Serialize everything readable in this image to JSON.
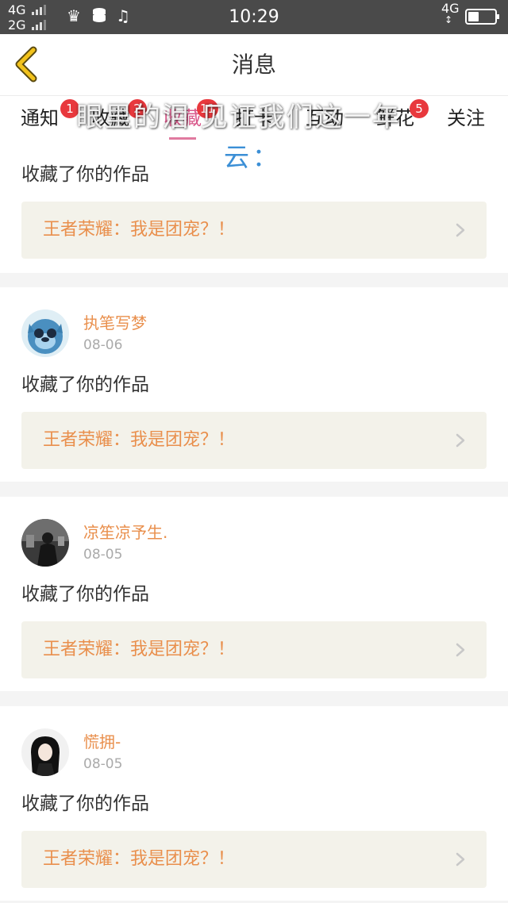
{
  "status_bar": {
    "network_1": "4G",
    "network_2": "2G",
    "time": "10:29",
    "network_right": "4G",
    "battery_level": 0.4
  },
  "header": {
    "title": "消息"
  },
  "tabs": [
    {
      "label": "通知",
      "badge": "1"
    },
    {
      "label": "收藏",
      "badge": "2"
    },
    {
      "label": "收藏",
      "badge": "11"
    },
    {
      "label": "打卡",
      "badge": ""
    },
    {
      "label": "互动",
      "badge": ""
    },
    {
      "label": "鲜花",
      "badge": "5"
    },
    {
      "label": "关注",
      "badge": ""
    }
  ],
  "overlay_caption": {
    "line1": "眼里的泪 见证我们这一年",
    "line2": "云："
  },
  "notifications": [
    {
      "user": "",
      "date": "",
      "action": "收藏了你的作品",
      "work": "王者荣耀：我是团宠？！"
    },
    {
      "user": "执笔写梦",
      "date": "08-06",
      "action": "收藏了你的作品",
      "work": "王者荣耀：我是团宠？！"
    },
    {
      "user": "凉笙凉予生.",
      "date": "08-05",
      "action": "收藏了你的作品",
      "work": "王者荣耀：我是团宠？！"
    },
    {
      "user": "慌拥-",
      "date": "08-05",
      "action": "收藏了你的作品",
      "work": "王者荣耀：我是团宠？！"
    }
  ],
  "colors": {
    "accent_pink": "#d9588b",
    "badge_red": "#e8383d",
    "name_orange": "#e98f4c",
    "back_yellow": "#f2c21b"
  }
}
